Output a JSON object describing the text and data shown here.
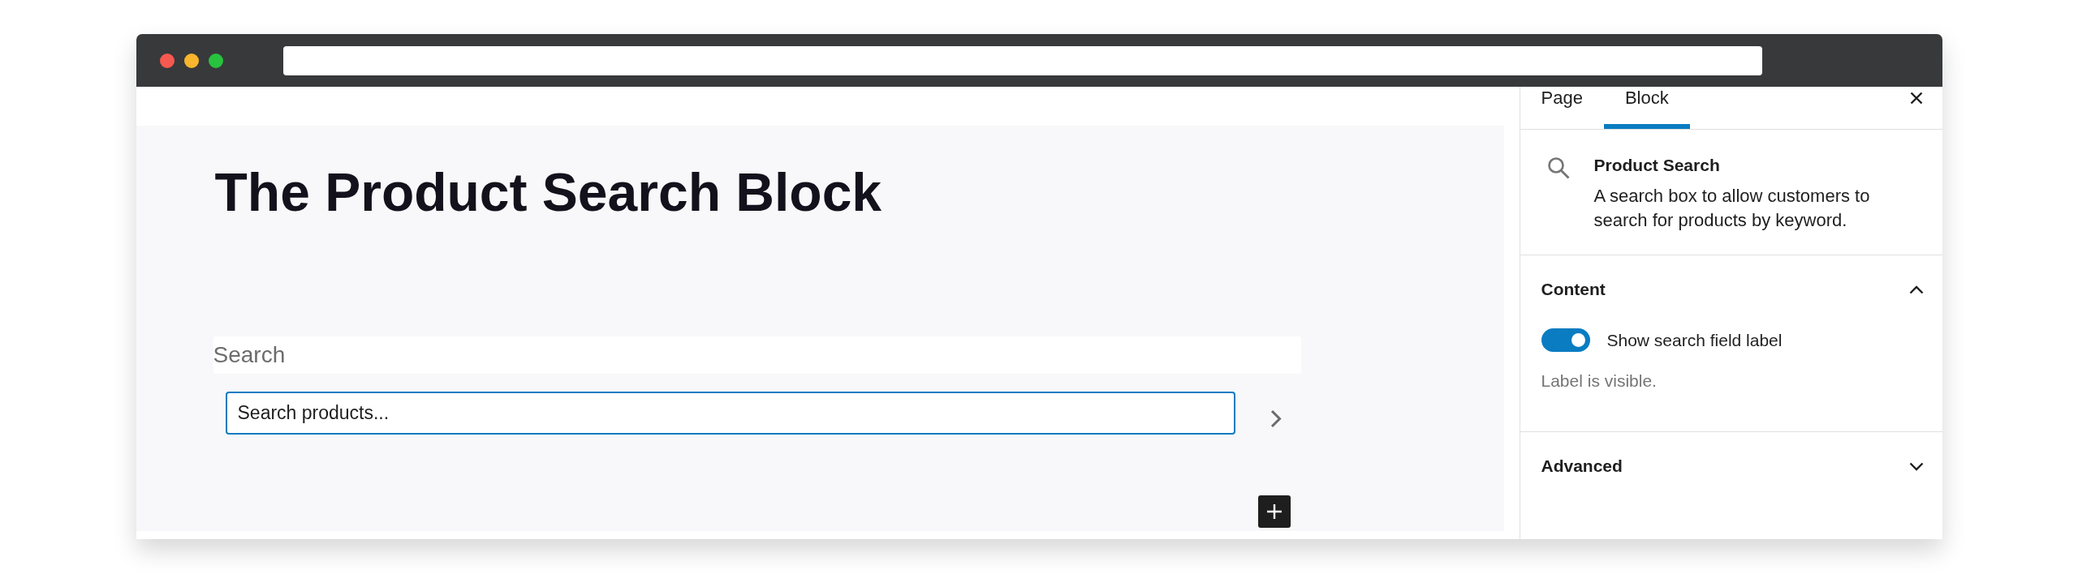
{
  "editor": {
    "title": "The Product Search Block",
    "search_block": {
      "label": "Search",
      "placeholder": "Search products..."
    }
  },
  "sidebar": {
    "tabs": [
      {
        "label": "Page",
        "selected": false
      },
      {
        "label": "Block",
        "selected": true
      }
    ],
    "block_card": {
      "title": "Product Search",
      "description": "A search box to allow customers to search for products by keyword."
    },
    "panels": [
      {
        "title": "Content",
        "expanded": true,
        "controls": [
          {
            "kind": "toggle",
            "label": "Show search field label",
            "on": true,
            "help": "Label is visible."
          }
        ]
      },
      {
        "title": "Advanced",
        "expanded": false
      }
    ]
  }
}
